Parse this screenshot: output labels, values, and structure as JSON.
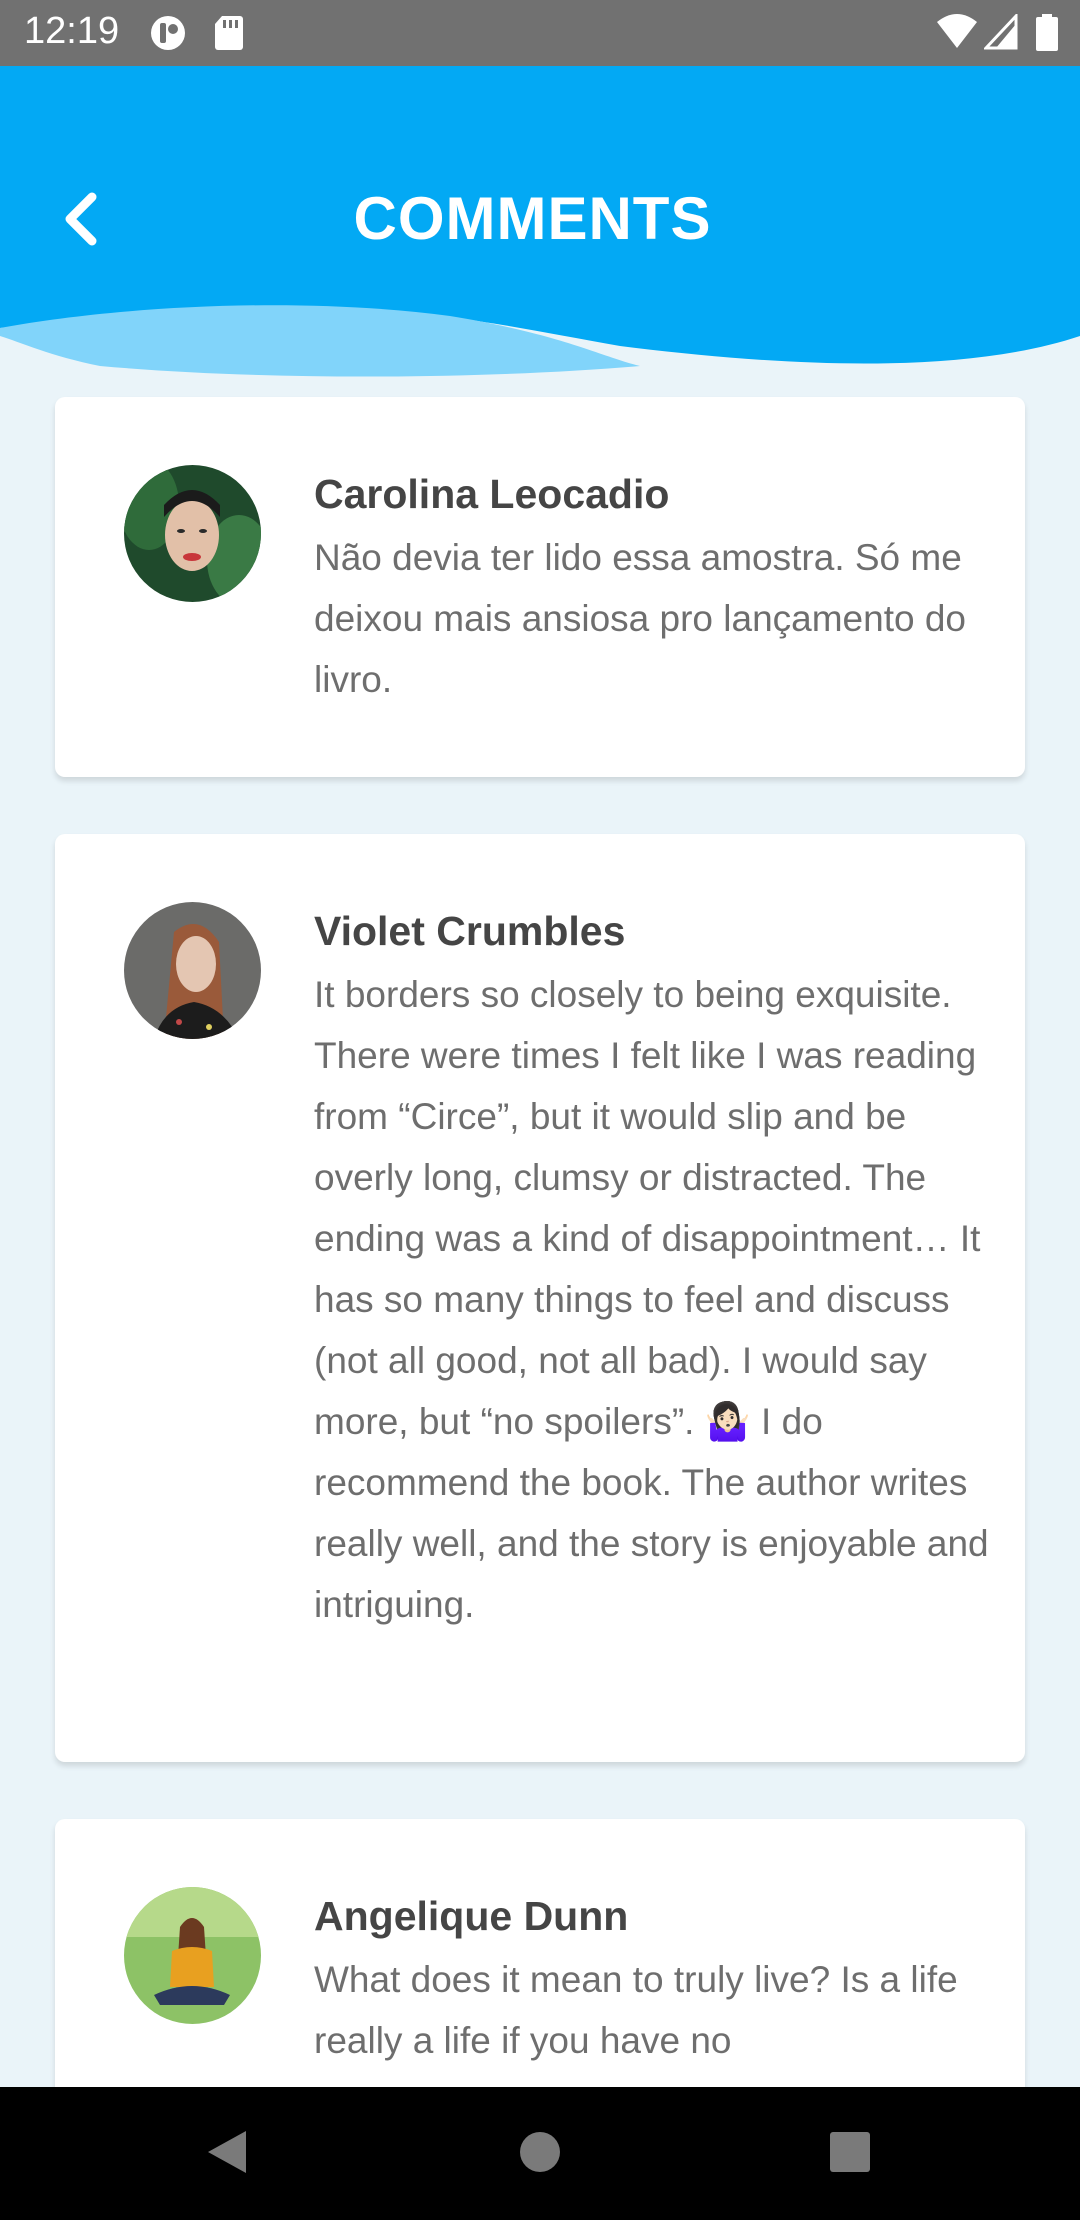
{
  "status_bar": {
    "time": "12:19",
    "left_icons": [
      "notification-icon",
      "sd-card-icon"
    ],
    "right_icons": [
      "wifi-icon",
      "signal-icon",
      "battery-icon"
    ]
  },
  "header": {
    "title": "COMMENTS",
    "back_icon": "chevron-left-icon",
    "background_color": "#03a9f4",
    "wave_color": "#81d4fa"
  },
  "comments": [
    {
      "name": "Carolina Leocadio",
      "text": "Não devia ter lido essa amostra. Só me deixou mais ansiosa pro lançamento do livro."
    },
    {
      "name": "Violet Crumbles",
      "text": "It borders so closely to being exquisite. There were times I felt like I was reading from “Circe”, but it would slip and be overly long, clumsy or distracted. The ending was a kind of disappointment… It has so many things to feel and discuss (not all good, not all bad). I would say more, but “no spoilers”. 🤷🏻‍♀️ I do recommend the book. The author writes really well, and the story is enjoyable and intriguing."
    },
    {
      "name": "Angelique Dunn",
      "text": "What does it mean to truly live? Is a life really a life if you have no"
    }
  ],
  "nav_bar": {
    "icons": [
      "back-triangle-icon",
      "home-circle-icon",
      "recents-square-icon"
    ]
  }
}
